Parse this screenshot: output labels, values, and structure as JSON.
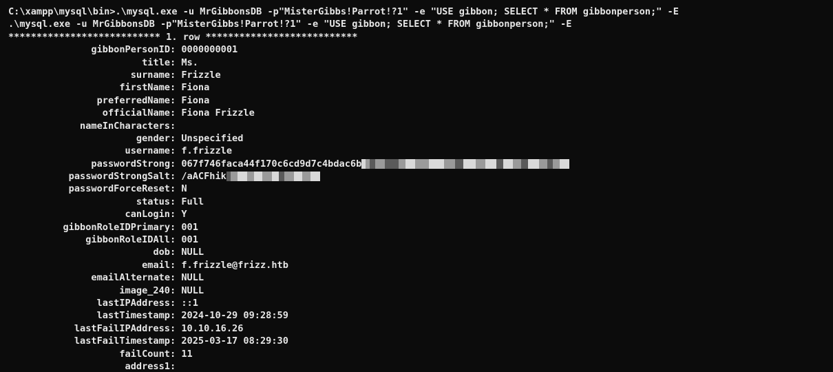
{
  "terminal": {
    "command_line": "C:\\xampp\\mysql\\bin>.\\mysql.exe -u MrGibbonsDB -p\"MisterGibbs!Parrot!?1\" -e \"USE gibbon; SELECT * FROM gibbonperson;\" -E",
    "echo_line": ".\\mysql.exe -u MrGibbonsDB -p\"MisterGibbs!Parrot!?1\" -e \"USE gibbon; SELECT * FROM gibbonperson;\" -E",
    "row_header": "*************************** 1. row ***************************",
    "fields": [
      {
        "name": "gibbonPersonID",
        "value": "0000000001"
      },
      {
        "name": "title",
        "value": "Ms."
      },
      {
        "name": "surname",
        "value": "Frizzle"
      },
      {
        "name": "firstName",
        "value": "Fiona"
      },
      {
        "name": "preferredName",
        "value": "Fiona"
      },
      {
        "name": "officialName",
        "value": "Fiona Frizzle"
      },
      {
        "name": "nameInCharacters",
        "value": ""
      },
      {
        "name": "gender",
        "value": "Unspecified"
      },
      {
        "name": "username",
        "value": "f.frizzle"
      },
      {
        "name": "passwordStrong",
        "value": "067f746faca44f170c6cd9d7c4bdac6b",
        "redacted": "wide"
      },
      {
        "name": "passwordStrongSalt",
        "value": "/aACFhik",
        "redacted": "narrow"
      },
      {
        "name": "passwordForceReset",
        "value": "N"
      },
      {
        "name": "status",
        "value": "Full"
      },
      {
        "name": "canLogin",
        "value": "Y"
      },
      {
        "name": "gibbonRoleIDPrimary",
        "value": "001"
      },
      {
        "name": "gibbonRoleIDAll",
        "value": "001"
      },
      {
        "name": "dob",
        "value": "NULL"
      },
      {
        "name": "email",
        "value": "f.frizzle@frizz.htb"
      },
      {
        "name": "emailAlternate",
        "value": "NULL"
      },
      {
        "name": "image_240",
        "value": "NULL"
      },
      {
        "name": "lastIPAddress",
        "value": "::1"
      },
      {
        "name": "lastTimestamp",
        "value": "2024-10-29 09:28:59"
      },
      {
        "name": "lastFailIPAddress",
        "value": "10.10.16.26"
      },
      {
        "name": "lastFailTimestamp",
        "value": "2025-03-17 08:29:30"
      },
      {
        "name": "failCount",
        "value": "11"
      },
      {
        "name": "address1",
        "value": ""
      }
    ]
  },
  "colors": {
    "background": "#0c0c0c",
    "text": "#e6e6e6",
    "redaction_light": "#d9d9d9",
    "redaction_mid": "#9a9a9a",
    "redaction_dark": "#5a5a5a"
  }
}
